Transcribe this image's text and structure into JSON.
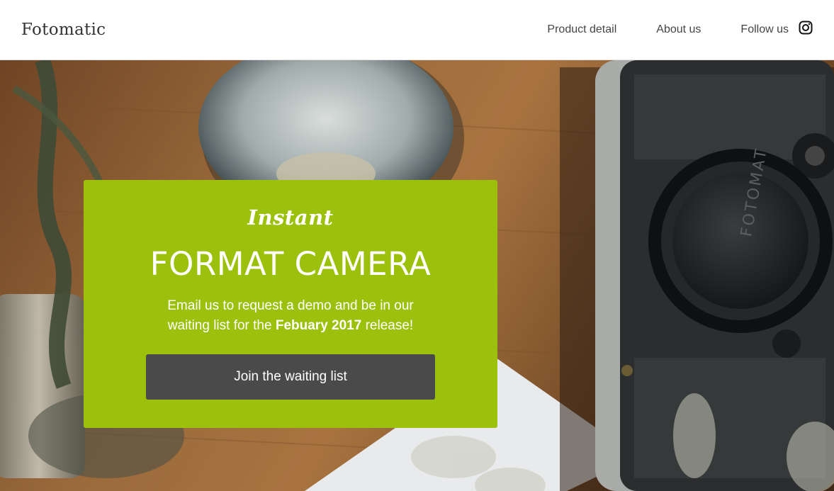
{
  "header": {
    "brand": "Fotomatic",
    "nav": [
      {
        "label": "Product detail"
      },
      {
        "label": "About us"
      },
      {
        "label": "Follow us"
      }
    ],
    "social_icon": "instagram-icon"
  },
  "hero": {
    "camera_text": "FOTOMAT",
    "card": {
      "kicker": "Instant",
      "headline": "FORMAT CAMERA",
      "desc_before": "Email us to request a demo and be in our waiting list for the",
      "desc_bold": "Febuary 2017",
      "desc_after": "release!",
      "cta_label": "Join the waiting list"
    }
  },
  "colors": {
    "accent": "#9bc10c",
    "button": "#4a4a4a"
  }
}
